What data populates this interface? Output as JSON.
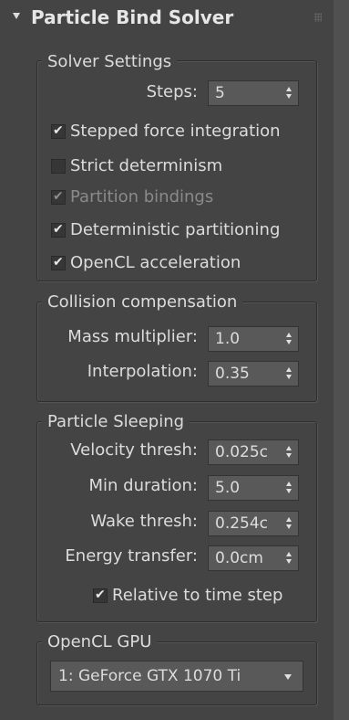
{
  "rollout": {
    "title": "Particle Bind Solver"
  },
  "solver_settings": {
    "title": "Solver Settings",
    "steps_label": "Steps:",
    "steps_value": "5",
    "checkboxes": [
      {
        "label": "Stepped force integration",
        "checked": true,
        "enabled": true
      },
      {
        "label": "Strict determinism",
        "checked": false,
        "enabled": true
      },
      {
        "label": "Partition bindings",
        "checked": true,
        "enabled": false
      },
      {
        "label": "Deterministic partitioning",
        "checked": true,
        "enabled": true
      },
      {
        "label": "OpenCL acceleration",
        "checked": true,
        "enabled": true
      }
    ]
  },
  "collision": {
    "title": "Collision compensation",
    "mass_label": "Mass multiplier:",
    "mass_value": "1.0",
    "interp_label": "Interpolation:",
    "interp_value": "0.35"
  },
  "sleeping": {
    "title": "Particle Sleeping",
    "velocity_label": "Velocity thresh:",
    "velocity_value": "0.025c",
    "min_duration_label": "Min duration:",
    "min_duration_value": "5.0",
    "wake_label": "Wake thresh:",
    "wake_value": "0.254c",
    "energy_label": "Energy transfer:",
    "energy_value": "0.0cm",
    "relative_label": "Relative to time step",
    "relative_checked": true
  },
  "gpu": {
    "title": "OpenCL GPU",
    "selected": "1: GeForce GTX 1070 Ti"
  },
  "colors": {
    "background": "#444444",
    "field": "#595959",
    "text": "#dcdcdc",
    "disabled_text": "#8a8a8a"
  }
}
